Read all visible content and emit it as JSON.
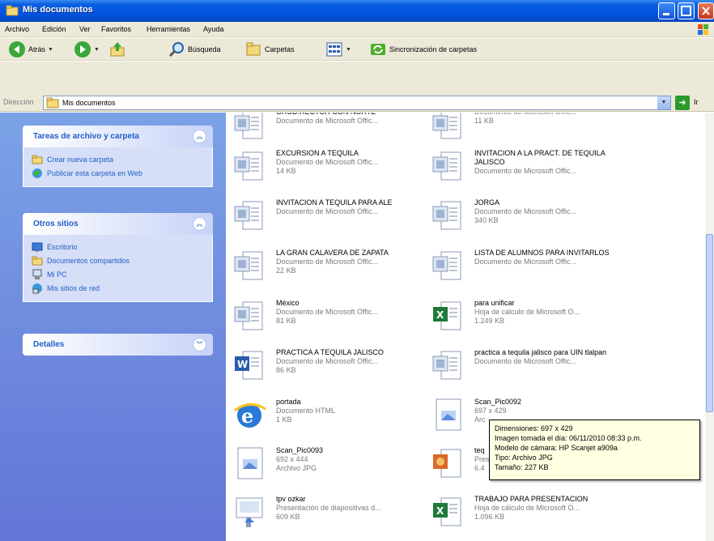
{
  "window": {
    "title": "Mis documentos"
  },
  "menu": [
    "Archivo",
    "Edición",
    "Ver",
    "Favoritos",
    "Herramientas",
    "Ayuda"
  ],
  "toolbar": {
    "back": "Atrás",
    "search": "Búsqueda",
    "folders": "Carpetas",
    "sync": "Sincronización de carpetas"
  },
  "address": {
    "label": "Dirección",
    "value": "Mis documentos",
    "go": "Ir"
  },
  "tasks": {
    "title": "Tareas de archivo y carpeta",
    "items": [
      "Crear nueva carpeta",
      "Publicar esta carpeta en Web"
    ]
  },
  "places": {
    "title": "Otros sitios",
    "items": [
      "Escritorio",
      "Documentos compartidos",
      "Mi PC",
      "Mis sitios de red"
    ]
  },
  "details": {
    "title": "Detalles"
  },
  "files": [
    {
      "name": "GRUD.RECTOR CON NORTE",
      "sub1": "Documento de Microsoft Offic...",
      "sub2": "",
      "type": "doc"
    },
    {
      "name": "",
      "sub1": "Documento de Microsoft Offic...",
      "sub2": "11 KB",
      "type": "doc"
    },
    {
      "name": "EXCURSION A TEQUILA",
      "sub1": "Documento de Microsoft Offic...",
      "sub2": "14 KB",
      "type": "doc"
    },
    {
      "name": "INVITACION A LA PRACT. DE TEQUILA JALISCO",
      "sub1": "Documento de Microsoft Offic...",
      "sub2": "",
      "type": "doc"
    },
    {
      "name": "INVITACION A TEQUILA PARA ALE",
      "sub1": "Documento de Microsoft Offic...",
      "sub2": "",
      "type": "doc"
    },
    {
      "name": "JORGA",
      "sub1": "Documento de Microsoft Offic...",
      "sub2": "340 KB",
      "type": "doc"
    },
    {
      "name": "LA GRAN CALAVERA DE ZAPATA",
      "sub1": "Documento de Microsoft Offic...",
      "sub2": "22 KB",
      "type": "doc"
    },
    {
      "name": "LISTA DE ALUMNOS PARA INVITARLOS",
      "sub1": "Documento de Microsoft Offic...",
      "sub2": "",
      "type": "doc"
    },
    {
      "name": "México",
      "sub1": "Documento de Microsoft Offic...",
      "sub2": "81 KB",
      "type": "doc"
    },
    {
      "name": "para unificar",
      "sub1": "Hoja de cálculo de Microsoft O...",
      "sub2": "1.249 KB",
      "type": "xls"
    },
    {
      "name": "PRACTICA A TEQUILA JALISCO",
      "sub1": "Documento de Microsoft Offic...",
      "sub2": "86 KB",
      "type": "word"
    },
    {
      "name": "practica a tequila jalisco para UIN tlalpan",
      "sub1": "Documento de Microsoft Offic...",
      "sub2": "",
      "type": "doc"
    },
    {
      "name": "portada",
      "sub1": "Documento HTML",
      "sub2": "1 KB",
      "type": "html"
    },
    {
      "name": "Scan_Pic0092",
      "sub1": "697 x 429",
      "sub2": "Arc",
      "type": "jpg"
    },
    {
      "name": "Scan_Pic0093",
      "sub1": "692 x 444",
      "sub2": "Archivo JPG",
      "type": "jpg"
    },
    {
      "name": "teq",
      "sub1": "Pres",
      "sub2": "6.4",
      "type": "ppt"
    },
    {
      "name": "tpv ozkar",
      "sub1": "Presentación de diapositivas d...",
      "sub2": "609 KB",
      "type": "pps"
    },
    {
      "name": "TRABAJO PARA PRESENTACION",
      "sub1": "Hoja de cálculo de Microsoft O...",
      "sub2": "1.096 KB",
      "type": "xls"
    }
  ],
  "tooltip": {
    "l1": "Dimensiones: 697 x 429",
    "l2": "Imagen tomada el día: 06/11/2010 08:33 p.m.",
    "l3": "Modelo de cámara: HP Scanjet a909a",
    "l4": "Tipo: Archivo JPG",
    "l5": "Tamaño: 227 KB"
  }
}
